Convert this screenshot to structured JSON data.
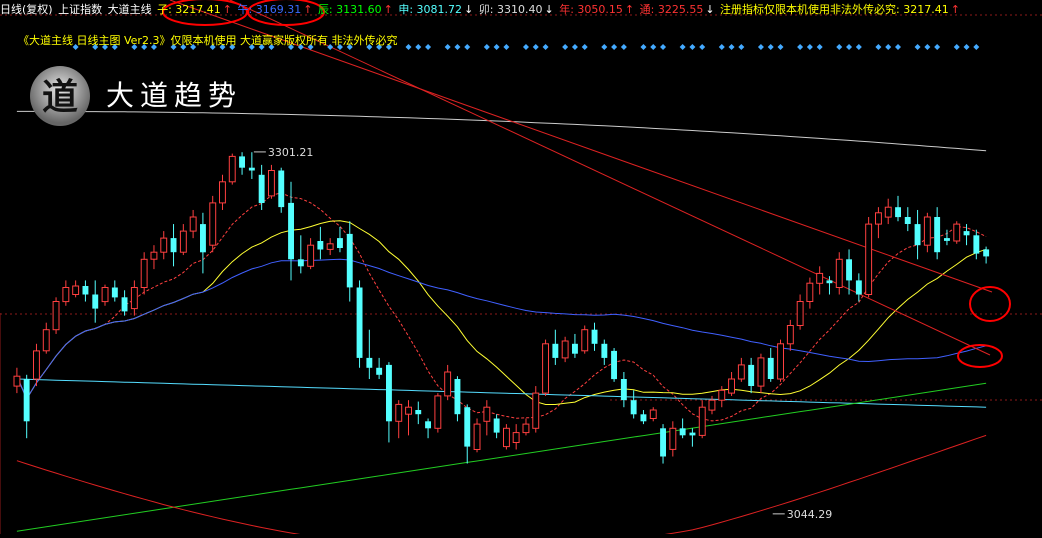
{
  "header": {
    "items": [
      {
        "label": "日线(复权)",
        "color": "#ffffff"
      },
      {
        "label": "上证指数",
        "color": "#ffffff"
      },
      {
        "label": "大道主线",
        "color": "#ffffff"
      },
      {
        "label": "子: 3217.41",
        "color": "#ffff00",
        "arrow": "↑"
      },
      {
        "label": "午: 3169.31",
        "color": "#3b6cff",
        "arrow": "↑"
      },
      {
        "label": "辰: 3131.60",
        "color": "#00ff00",
        "arrow": "↑"
      },
      {
        "label": "申: 3081.72",
        "color": "#55ffff",
        "arrow": "↓"
      },
      {
        "label": "卯: 3310.40",
        "color": "#dddddd",
        "arrow": "↓"
      },
      {
        "label": "年: 3050.15",
        "color": "#ff3333",
        "arrow": "↑"
      },
      {
        "label": "通: 3225.55",
        "color": "#ff3333",
        "arrow": "↓"
      },
      {
        "label": "注册指标仅限本机使用非法外传必究: 3217.41",
        "color": "#ffff00",
        "arrow": "↑"
      }
    ]
  },
  "subtitle": "《大道主线 日线主图 Ver2.3》仅限本机使用 大道赢家版权所有 非法外传必究",
  "logo": {
    "glyph": "道",
    "text": "大道趋势"
  },
  "colors": {
    "bg": "#000000",
    "up": "#ff4040",
    "down": "#54ffff",
    "ma_yellow": "#ffff33",
    "ma_red_dashed": "#ff4040",
    "ma_blue": "#4060ff",
    "ma_cyan": "#55ddff",
    "ma_green": "#22cc22",
    "ma_red": "#dd2222",
    "ma_white": "#cccccc",
    "trendline": "#dd2222",
    "annotation": "#ff0000",
    "diamond": "#44aaff"
  },
  "chart_data": {
    "type": "candlestick",
    "title": "上证指数 日线(复权)",
    "ylim": [
      3030,
      3370
    ],
    "annotations": [
      {
        "text": "3301.21",
        "price": 3301.21,
        "index": 24
      },
      {
        "text": "3044.29",
        "price": 3044.29,
        "index": 77
      }
    ],
    "candles": [
      [
        3135,
        3148,
        3130,
        3142
      ],
      [
        3140,
        3143,
        3098,
        3110
      ],
      [
        3140,
        3165,
        3135,
        3160
      ],
      [
        3160,
        3180,
        3158,
        3175
      ],
      [
        3175,
        3198,
        3172,
        3195
      ],
      [
        3195,
        3210,
        3192,
        3205
      ],
      [
        3200,
        3210,
        3198,
        3206
      ],
      [
        3206,
        3210,
        3195,
        3200
      ],
      [
        3200,
        3210,
        3180,
        3190
      ],
      [
        3195,
        3207,
        3192,
        3205
      ],
      [
        3205,
        3210,
        3195,
        3198
      ],
      [
        3198,
        3203,
        3185,
        3188
      ],
      [
        3190,
        3210,
        3185,
        3205
      ],
      [
        3205,
        3230,
        3200,
        3225
      ],
      [
        3225,
        3235,
        3218,
        3230
      ],
      [
        3230,
        3245,
        3225,
        3240
      ],
      [
        3240,
        3250,
        3220,
        3230
      ],
      [
        3230,
        3250,
        3228,
        3245
      ],
      [
        3245,
        3260,
        3240,
        3255
      ],
      [
        3250,
        3258,
        3215,
        3230
      ],
      [
        3235,
        3270,
        3230,
        3265
      ],
      [
        3265,
        3285,
        3260,
        3280
      ],
      [
        3280,
        3300,
        3278,
        3298
      ],
      [
        3298,
        3301,
        3285,
        3290
      ],
      [
        3290,
        3301,
        3282,
        3288
      ],
      [
        3285,
        3292,
        3260,
        3265
      ],
      [
        3270,
        3292,
        3268,
        3288
      ],
      [
        3288,
        3290,
        3258,
        3262
      ],
      [
        3265,
        3280,
        3210,
        3225
      ],
      [
        3225,
        3242,
        3215,
        3220
      ],
      [
        3220,
        3240,
        3218,
        3235
      ],
      [
        3238,
        3248,
        3225,
        3232
      ],
      [
        3232,
        3240,
        3228,
        3236
      ],
      [
        3240,
        3248,
        3230,
        3233
      ],
      [
        3243,
        3252,
        3195,
        3205
      ],
      [
        3205,
        3210,
        3148,
        3155
      ],
      [
        3155,
        3175,
        3140,
        3148
      ],
      [
        3148,
        3155,
        3140,
        3143
      ],
      [
        3150,
        3152,
        3095,
        3110
      ],
      [
        3110,
        3125,
        3098,
        3122
      ],
      [
        3115,
        3125,
        3100,
        3120
      ],
      [
        3118,
        3124,
        3108,
        3115
      ],
      [
        3110,
        3112,
        3098,
        3105
      ],
      [
        3105,
        3130,
        3102,
        3128
      ],
      [
        3128,
        3150,
        3125,
        3145
      ],
      [
        3140,
        3142,
        3110,
        3115
      ],
      [
        3120,
        3122,
        3080,
        3092
      ],
      [
        3090,
        3112,
        3088,
        3108
      ],
      [
        3110,
        3125,
        3100,
        3120
      ],
      [
        3112,
        3115,
        3098,
        3102
      ],
      [
        3092,
        3108,
        3090,
        3105
      ],
      [
        3095,
        3108,
        3090,
        3102
      ],
      [
        3102,
        3112,
        3100,
        3108
      ],
      [
        3105,
        3135,
        3102,
        3130
      ],
      [
        3130,
        3168,
        3128,
        3165
      ],
      [
        3165,
        3175,
        3150,
        3155
      ],
      [
        3155,
        3170,
        3152,
        3167
      ],
      [
        3165,
        3172,
        3155,
        3158
      ],
      [
        3160,
        3178,
        3158,
        3175
      ],
      [
        3175,
        3180,
        3160,
        3165
      ],
      [
        3165,
        3168,
        3150,
        3155
      ],
      [
        3160,
        3162,
        3138,
        3140
      ],
      [
        3140,
        3145,
        3120,
        3125
      ],
      [
        3125,
        3132,
        3112,
        3115
      ],
      [
        3115,
        3118,
        3108,
        3110
      ],
      [
        3112,
        3120,
        3110,
        3118
      ],
      [
        3105,
        3108,
        3080,
        3085
      ],
      [
        3090,
        3110,
        3085,
        3105
      ],
      [
        3105,
        3112,
        3098,
        3100
      ],
      [
        3102,
        3105,
        3092,
        3100
      ],
      [
        3100,
        3125,
        3098,
        3120
      ],
      [
        3118,
        3128,
        3115,
        3125
      ],
      [
        3125,
        3135,
        3120,
        3132
      ],
      [
        3130,
        3145,
        3128,
        3140
      ],
      [
        3140,
        3155,
        3138,
        3150
      ],
      [
        3150,
        3155,
        3130,
        3135
      ],
      [
        3135,
        3158,
        3130,
        3155
      ],
      [
        3155,
        3162,
        3138,
        3140
      ],
      [
        3140,
        3168,
        3138,
        3165
      ],
      [
        3165,
        3182,
        3160,
        3178
      ],
      [
        3178,
        3200,
        3175,
        3195
      ],
      [
        3195,
        3212,
        3190,
        3208
      ],
      [
        3208,
        3220,
        3200,
        3215
      ],
      [
        3210,
        3213,
        3200,
        3208
      ],
      [
        3205,
        3230,
        3200,
        3225
      ],
      [
        3225,
        3232,
        3200,
        3210
      ],
      [
        3210,
        3215,
        3195,
        3200
      ],
      [
        3200,
        3255,
        3198,
        3250
      ],
      [
        3250,
        3262,
        3240,
        3258
      ],
      [
        3255,
        3268,
        3250,
        3262
      ],
      [
        3262,
        3270,
        3252,
        3255
      ],
      [
        3255,
        3262,
        3245,
        3250
      ],
      [
        3250,
        3260,
        3225,
        3235
      ],
      [
        3235,
        3258,
        3230,
        3255
      ],
      [
        3255,
        3262,
        3225,
        3230
      ],
      [
        3240,
        3246,
        3235,
        3238
      ],
      [
        3238,
        3252,
        3236,
        3250
      ],
      [
        3245,
        3250,
        3235,
        3242
      ],
      [
        3242,
        3246,
        3225,
        3229
      ],
      [
        3232,
        3234,
        3222,
        3227
      ]
    ]
  }
}
